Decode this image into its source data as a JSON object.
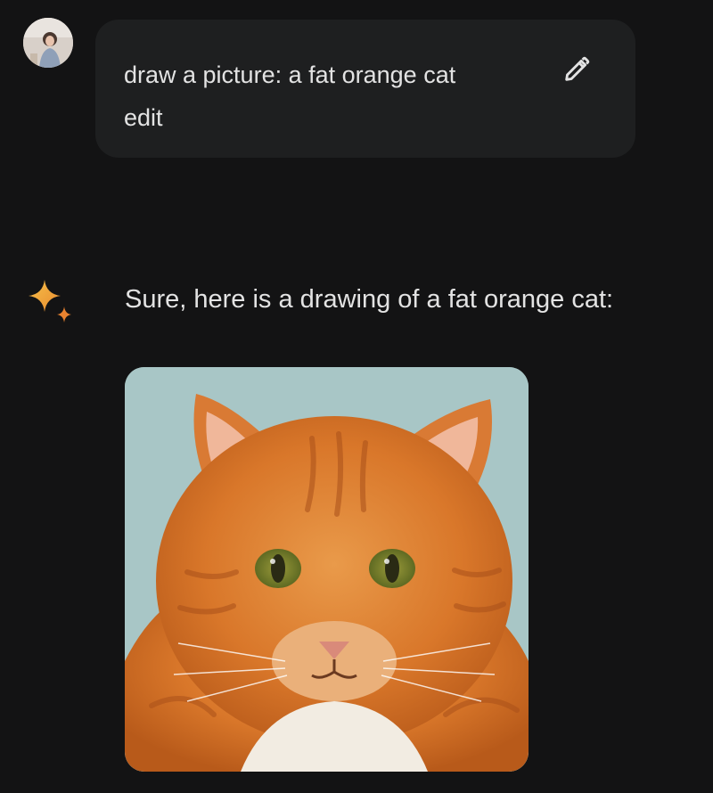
{
  "user_message": {
    "text": "draw a picture: a fat orange cat",
    "edit_label": "edit",
    "avatar_icon": "user-avatar",
    "edit_icon": "pencil-icon"
  },
  "assistant_message": {
    "text": "Sure, here is a drawing of a fat orange cat:",
    "icon": "sparkle-icon",
    "image_subject": "fat orange tabby cat drawing"
  },
  "colors": {
    "background": "#131314",
    "bubble": "#1e1f20",
    "text": "#e3e3e3",
    "sparkle_primary": "#f2a93b",
    "sparkle_secondary": "#e8822f"
  }
}
